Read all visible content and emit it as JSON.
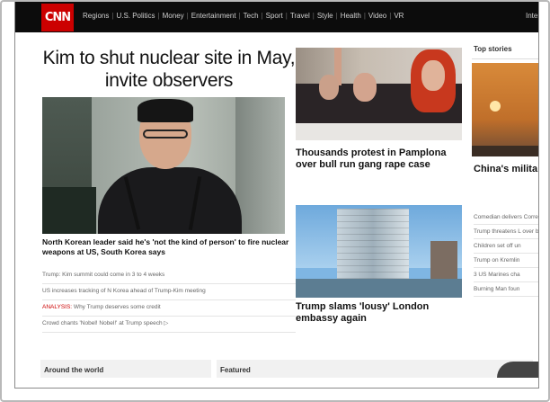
{
  "nav": {
    "logo": "CNN",
    "items": [
      "Regions",
      "U.S. Politics",
      "Money",
      "Entertainment",
      "Tech",
      "Sport",
      "Travel",
      "Style",
      "Health",
      "Video",
      "VR"
    ],
    "right": "Inter"
  },
  "main": {
    "headline": "Kim to shut nuclear site in May, invite observers",
    "caption": "North Korean leader said he's 'not the kind of person' to fire nuclear weapons at US, South Korea says",
    "links": [
      {
        "prefix": "",
        "text": "Trump: Kim summit could come in 3 to 4 weeks"
      },
      {
        "prefix": "",
        "text": "US increases tracking of N Korea ahead of Trump-Kim meeting"
      },
      {
        "prefix": "ANALYSIS:",
        "text": " Why Trump deserves some credit"
      },
      {
        "prefix": "",
        "text": "Crowd chants 'Nobel! Nobel!' at Trump speech ▷"
      }
    ]
  },
  "middle": {
    "story1": "Thousands protest in Pamplona over bull run gang rape case",
    "story2": "Trump slams 'lousy' London embassy again"
  },
  "sidebar": {
    "title": "Top stories",
    "headline": "China's milita protect Taiw the motherla",
    "links": [
      "Comedian delivers Correspondents' D",
      "Trump threatens L over border secur",
      "Children set off un",
      "Trump on Kremlin",
      "3 US Marines cha",
      "Burning Man foun"
    ]
  },
  "bottom": {
    "section1": "Around the world",
    "section2": "Featured"
  },
  "colors": {
    "brand_red": "#cc0000",
    "navbar": "#0c0c0c"
  }
}
